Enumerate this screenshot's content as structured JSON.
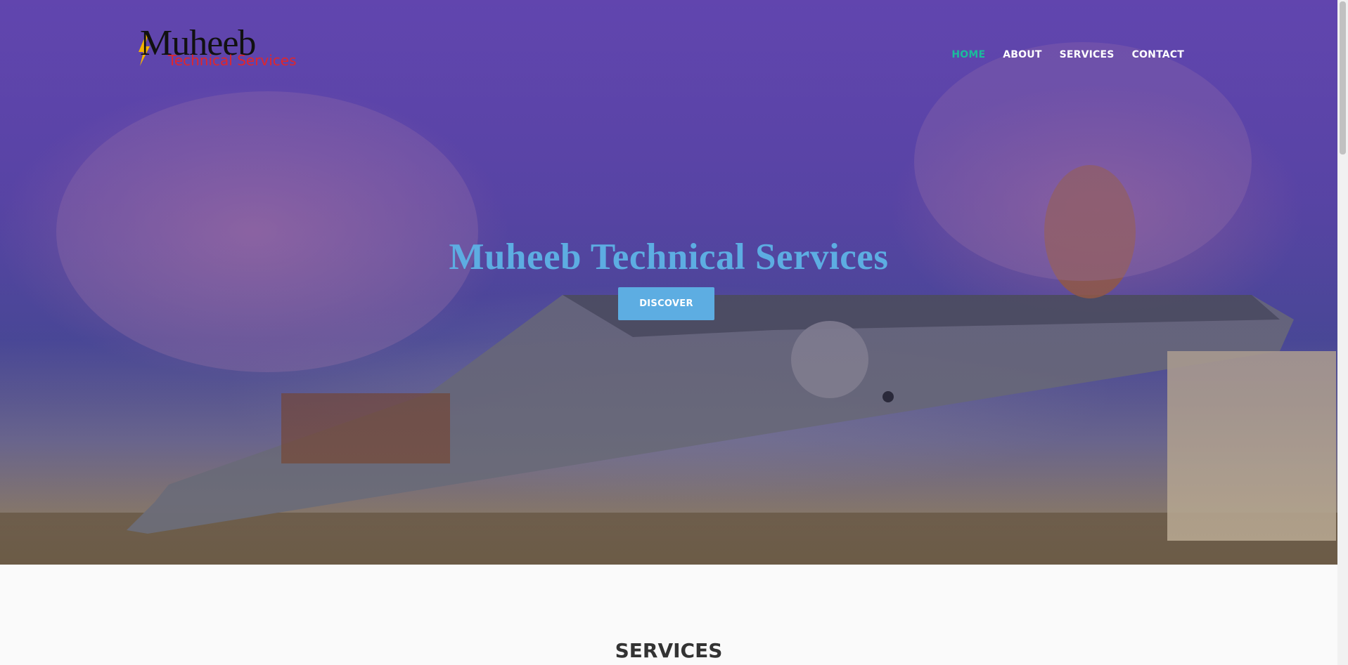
{
  "logo": {
    "main": "Muheeb",
    "sub": "Technical Services"
  },
  "nav": {
    "items": [
      {
        "label": "HOME",
        "active": true
      },
      {
        "label": "ABOUT",
        "active": false
      },
      {
        "label": "SERVICES",
        "active": false
      },
      {
        "label": "CONTACT",
        "active": false
      }
    ]
  },
  "hero": {
    "title": "Muheeb Technical Services",
    "button_label": "DISCOVER"
  },
  "services": {
    "heading": "SERVICES"
  },
  "colors": {
    "accent": "#5dade2",
    "nav_active": "#1abc9c",
    "logo_sub": "#e0262c"
  }
}
